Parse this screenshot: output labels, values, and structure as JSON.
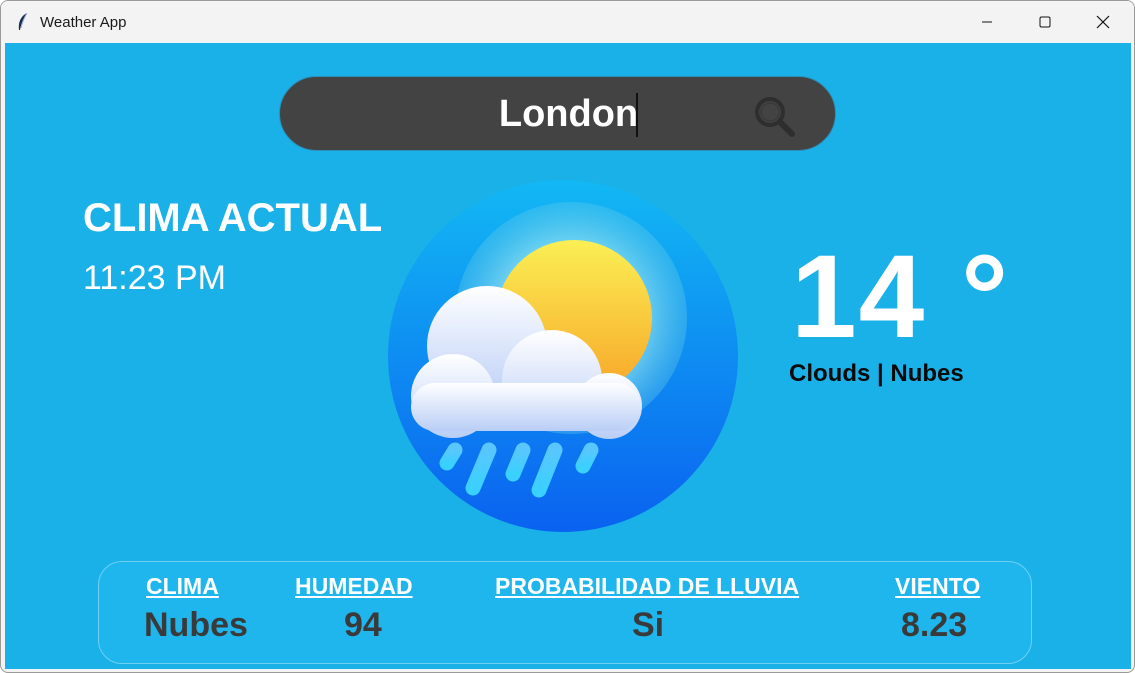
{
  "window": {
    "title": "Weather App"
  },
  "search": {
    "value": "London"
  },
  "current": {
    "heading": "CLIMA ACTUAL",
    "time": "11:23 PM",
    "temperature": "14 °",
    "condition": "Clouds | Nubes"
  },
  "stats": {
    "clima": {
      "label": "CLIMA",
      "value": "Nubes"
    },
    "humedad": {
      "label": "HUMEDAD",
      "value": "94"
    },
    "lluvia": {
      "label": "PROBABILIDAD DE LLUVIA",
      "value": "Si"
    },
    "viento": {
      "label": "VIENTO",
      "value": "8.23"
    }
  },
  "colors": {
    "background": "#1ab0e8",
    "search_bar": "#434343",
    "value_text": "#3a3a3a"
  },
  "icons": [
    "feather-icon",
    "minimize-icon",
    "maximize-icon",
    "close-icon",
    "search-icon",
    "weather-cloud-sun-rain-icon"
  ]
}
